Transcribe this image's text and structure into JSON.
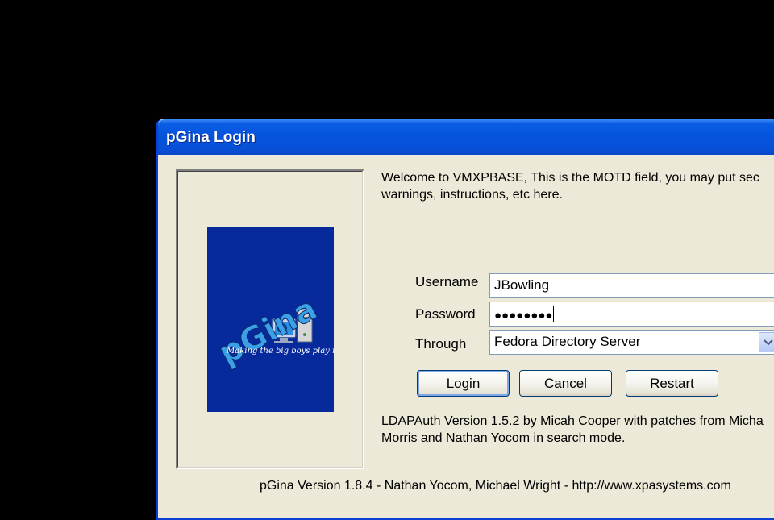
{
  "window": {
    "title": "pGina Login"
  },
  "logo": {
    "name": "pGina",
    "tagline": "Making the big boys play nice!"
  },
  "motd": [
    "Welcome to VMXPBASE, This is the MOTD field, you may put sec",
    "warnings, instructions, etc here."
  ],
  "form": {
    "username_label": "Username",
    "username_value": "JBowling",
    "password_label": "Password",
    "password_mask": "●●●●●●●●",
    "through_label": "Through",
    "through_value": "Fedora Directory Server"
  },
  "buttons": {
    "login": "Login",
    "cancel": "Cancel",
    "restart": "Restart"
  },
  "plugin_info": [
    "LDAPAuth Version 1.5.2 by Micah Cooper with patches from Micha",
    "Morris and Nathan Yocom in search mode."
  ],
  "footer": "pGina Version 1.8.4 - Nathan Yocom, Michael Wright - http://www.xpasystems.com",
  "colors": {
    "desktop": "#000000",
    "titlebar": "#0653dc",
    "dialog_bg": "#ece9d8",
    "logo_bg": "#062a9c",
    "logo_text": "#3aa0e8"
  }
}
